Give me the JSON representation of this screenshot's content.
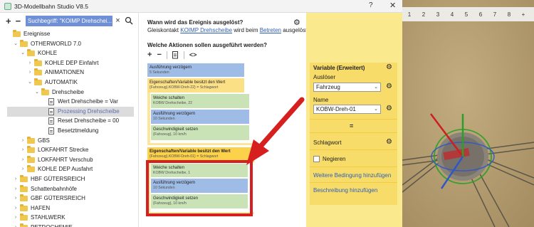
{
  "window": {
    "title": "3D-Modellbahn Studio V8.5",
    "help": "?",
    "close": "✕"
  },
  "left": {
    "toolbar": {
      "add": "+",
      "remove": "−"
    },
    "search": {
      "value": "Suchbegriff: \"KOIMP Drehschei...",
      "clear": "×"
    },
    "tree": [
      {
        "label": "Ereignisse",
        "icon": "folder-icon",
        "chevron": ""
      },
      {
        "label": "OTHERWORLD  7.0",
        "icon": "folder-icon",
        "chevron": "⌄"
      },
      {
        "label": "KOHLE",
        "icon": "folder-icon",
        "chevron": "⌄"
      },
      {
        "label": "KOHLE  DEP  Einfahrt",
        "icon": "folder-icon",
        "chevron": "›"
      },
      {
        "label": "ANIMATIONEN",
        "icon": "folder-icon",
        "chevron": "›"
      },
      {
        "label": "AUTOMATIK",
        "icon": "folder-icon",
        "chevron": "⌄"
      },
      {
        "label": "Drehscheibe",
        "icon": "folder-icon",
        "chevron": "⌄"
      },
      {
        "label": "Wert Drehscheibe = Var",
        "icon": "document-icon",
        "chevron": ""
      },
      {
        "label": "Prozessing Drehscheibe",
        "icon": "document-icon",
        "chevron": "",
        "selected": true
      },
      {
        "label": "Reset Drehscheibe = 00",
        "icon": "document-icon",
        "chevron": ""
      },
      {
        "label": "Besetztmeldung",
        "icon": "document-icon",
        "chevron": ""
      },
      {
        "label": "GBS",
        "icon": "folder-icon",
        "chevron": "›"
      },
      {
        "label": "LOKFAHRT  Strecke",
        "icon": "folder-icon",
        "chevron": "›"
      },
      {
        "label": "LOKFAHRT  Verschub",
        "icon": "folder-icon",
        "chevron": "›"
      },
      {
        "label": "KOHLE  DEP  Ausfahrt",
        "icon": "folder-icon",
        "chevron": "›"
      },
      {
        "label": "HBF  GÜTERSREICH",
        "icon": "folder-icon",
        "chevron": "›"
      },
      {
        "label": "Schattenbahnhöfe",
        "icon": "folder-icon",
        "chevron": "›"
      },
      {
        "label": "GBF  GÜTERSREICH",
        "icon": "folder-icon",
        "chevron": "›"
      },
      {
        "label": "HAFEN",
        "icon": "folder-icon",
        "chevron": "›"
      },
      {
        "label": "STAHLWERK",
        "icon": "folder-icon",
        "chevron": "›"
      },
      {
        "label": "PETROCHEMIE",
        "icon": "folder-icon",
        "chevron": "›"
      }
    ]
  },
  "middle": {
    "question1": "Wann wird das Ereignis ausgelöst?",
    "trigger": {
      "pre": "Gleiskontakt ",
      "object": "KOIMP Drehscheibe",
      "mid": " wird beim ",
      "action": "Betreten",
      "post": " ausgelöst."
    },
    "question2": "Welche Aktionen sollen ausgeführt werden?",
    "toolbar": {
      "add": "+",
      "remove": "−",
      "copy_icon": "copy-icon",
      "code": "<>"
    },
    "actions": [
      {
        "title": "Ausführung verzögern",
        "sub": "5 Sekunden",
        "color": "blue"
      },
      {
        "title": "Eigenschaften/Variable besitzt den Wert",
        "sub": "{Fahrzeug}.KOBW-Dreh-22} = Schlagwort",
        "color": "yellow"
      },
      {
        "title": "Weiche schalten",
        "sub": "KOBW  Drehscheibe, 22",
        "color": "green"
      },
      {
        "title": "Ausführung verzögern",
        "sub": "10 Sekunden",
        "color": "blue"
      },
      {
        "title": "Geschwindigkeit setzen",
        "sub": "{Fahrzeug}, 10 km/h",
        "color": "green"
      },
      {
        "title": "Eigenschaften/Variable besitzt den Wert",
        "sub": "{Fahrzeug}.KOBW-Dreh-01} = Schlagwort",
        "color": "yellow"
      },
      {
        "title": "Weiche schalten",
        "sub": "KOBW  Drehscheibe, 1",
        "color": "green"
      },
      {
        "title": "Ausführung verzögern",
        "sub": "10 Sekunden",
        "color": "blue"
      },
      {
        "title": "Geschwindigkeit setzen",
        "sub": "{Fahrzeug}, 10 km/h",
        "color": "green"
      }
    ]
  },
  "condition": {
    "header": "Variable (Erweitert)",
    "trigger_label": "Auslöser",
    "trigger_value": "Fahrzeug",
    "name_label": "Name",
    "name_value": "KOBW-Dreh-01",
    "operator": "=",
    "keyword": "Schlagwort",
    "negate": "Negieren",
    "add_condition": "Weitere Bedingung hinzufügen",
    "add_description": "Beschreibung hinzufügen"
  },
  "scene": {
    "toolbar": [
      "1",
      "2",
      "3",
      "4",
      "5",
      "6",
      "7",
      "8",
      "+"
    ]
  },
  "colors": {
    "blue": "#9fbce6",
    "yellow": "#fbe086",
    "green": "#c9e3b6",
    "highlight_red": "#d6201f",
    "panel_yellow": "#fbe98e"
  }
}
